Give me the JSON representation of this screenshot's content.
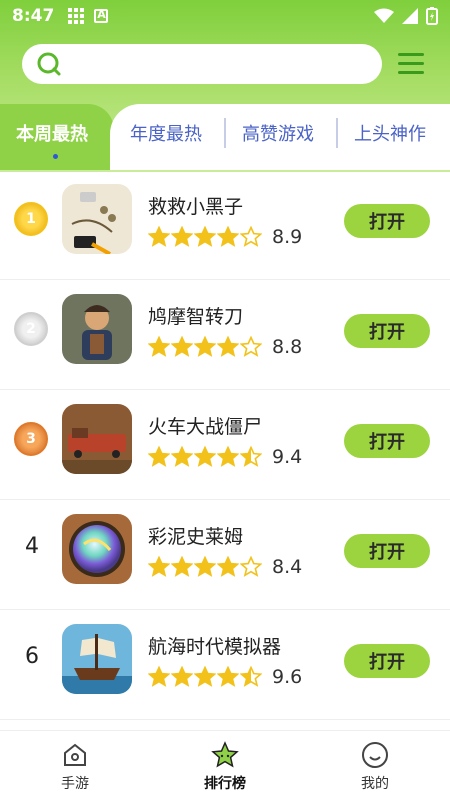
{
  "status_bar": {
    "time": "8:47"
  },
  "search": {
    "placeholder": ""
  },
  "tabs": [
    {
      "label": "本周最热",
      "active": true
    },
    {
      "label": "年度最热",
      "active": false
    },
    {
      "label": "高赞游戏",
      "active": false
    },
    {
      "label": "上头神作",
      "active": false
    }
  ],
  "games": [
    {
      "rank": "1",
      "name": "救救小黑子",
      "rating": "8.9",
      "stars": 4,
      "button": "打开",
      "icon": "stickman-rescue-icon"
    },
    {
      "rank": "2",
      "name": "鸠摩智转刀",
      "rating": "8.8",
      "stars": 4,
      "button": "打开",
      "icon": "monk-character-icon"
    },
    {
      "rank": "3",
      "name": "火车大战僵尸",
      "rating": "9.4",
      "stars": 4.5,
      "button": "打开",
      "icon": "train-battle-icon"
    },
    {
      "rank": "4",
      "name": "彩泥史莱姆",
      "rating": "8.4",
      "stars": 4,
      "button": "打开",
      "icon": "slime-orb-icon"
    },
    {
      "rank": "6",
      "name": "航海时代模拟器",
      "rating": "9.6",
      "stars": 4.5,
      "button": "打开",
      "icon": "pirate-ship-icon"
    }
  ],
  "bottom_nav": [
    {
      "label": "手游",
      "icon": "home-icon",
      "active": false
    },
    {
      "label": "排行榜",
      "icon": "star-icon",
      "active": true
    },
    {
      "label": "我的",
      "icon": "smiley-icon",
      "active": false
    }
  ],
  "colors": {
    "accent": "#8fd147",
    "button": "#9bd43e",
    "tab_text": "#4b63c6",
    "star": "#f2c21b"
  }
}
